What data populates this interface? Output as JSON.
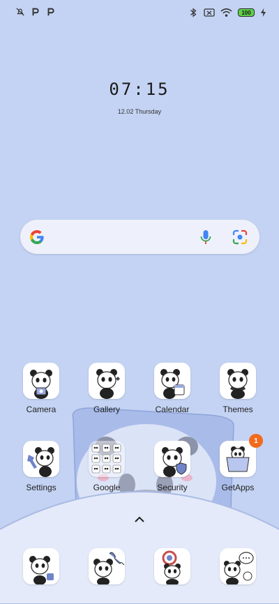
{
  "status_bar": {
    "left_icons": [
      "alarm-off-icon",
      "parking-app-icon",
      "parking-app-icon"
    ],
    "right_icons": [
      "bluetooth-icon",
      "sim-off-icon",
      "wifi-icon"
    ],
    "battery_level": "100",
    "charging_icon": "bolt-icon"
  },
  "clock": {
    "time": "07:15",
    "date": "12.02 Thursday"
  },
  "search": {
    "logo": "google-g-icon",
    "mic": "mic-icon",
    "lens": "google-lens-icon"
  },
  "apps_row1": [
    {
      "label": "Camera"
    },
    {
      "label": "Gallery"
    },
    {
      "label": "Calendar"
    },
    {
      "label": "Themes"
    }
  ],
  "apps_row2": [
    {
      "label": "Settings"
    },
    {
      "label": "Google"
    },
    {
      "label": "Security"
    },
    {
      "label": "GetApps",
      "badge": "1"
    }
  ],
  "dock_icons": [
    "phone-app-icon",
    "dialer-icon",
    "chrome-icon",
    "messages-icon"
  ],
  "colors": {
    "wallpaper": "#c4d3f3",
    "badge": "#f26b1d",
    "battery": "#5fd14a"
  }
}
